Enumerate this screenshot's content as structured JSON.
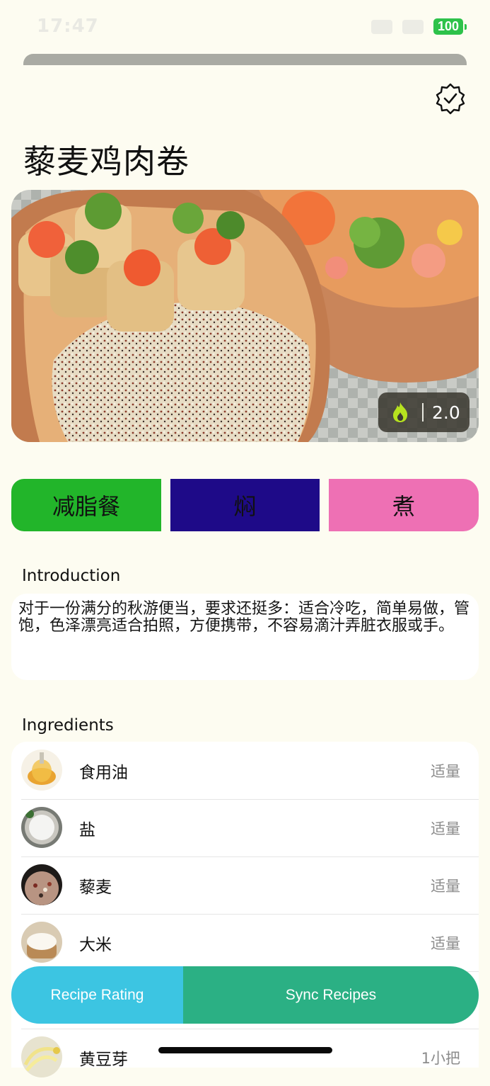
{
  "status_bar": {
    "time": "17:47",
    "battery": "100"
  },
  "recipe": {
    "title": "藜麦鸡肉卷",
    "score": "2.0"
  },
  "tags": [
    "减脂餐",
    "焖",
    "煮"
  ],
  "introduction": {
    "heading": "Introduction",
    "text": "对于一份满分的秋游便当，要求还挺多：适合冷吃，简单易做，管饱，色泽漂亮适合拍照，方便携带，不容易滴汁弄脏衣服或手。"
  },
  "ingredients": {
    "heading": "Ingredients",
    "items": [
      {
        "name": "食用油",
        "amount": "适量"
      },
      {
        "name": "盐",
        "amount": "适量"
      },
      {
        "name": "藜麦",
        "amount": "适量"
      },
      {
        "name": "大米",
        "amount": "适量"
      },
      {
        "name": "",
        "amount": ""
      },
      {
        "name": "黄豆芽",
        "amount": "1小把"
      }
    ]
  },
  "actions": {
    "rating_label": "Recipe Rating",
    "sync_label": "Sync Recipes"
  },
  "colors": {
    "background": "#fdfcf1",
    "tag_1": "#22b52a",
    "tag_2": "#1e0a88",
    "tag_3": "#ee70b4",
    "rating_button": "#3cc5e2",
    "sync_button": "#2bb084",
    "battery": "#2dc24a"
  },
  "icons": [
    "verified-badge-icon",
    "flame-icon"
  ]
}
